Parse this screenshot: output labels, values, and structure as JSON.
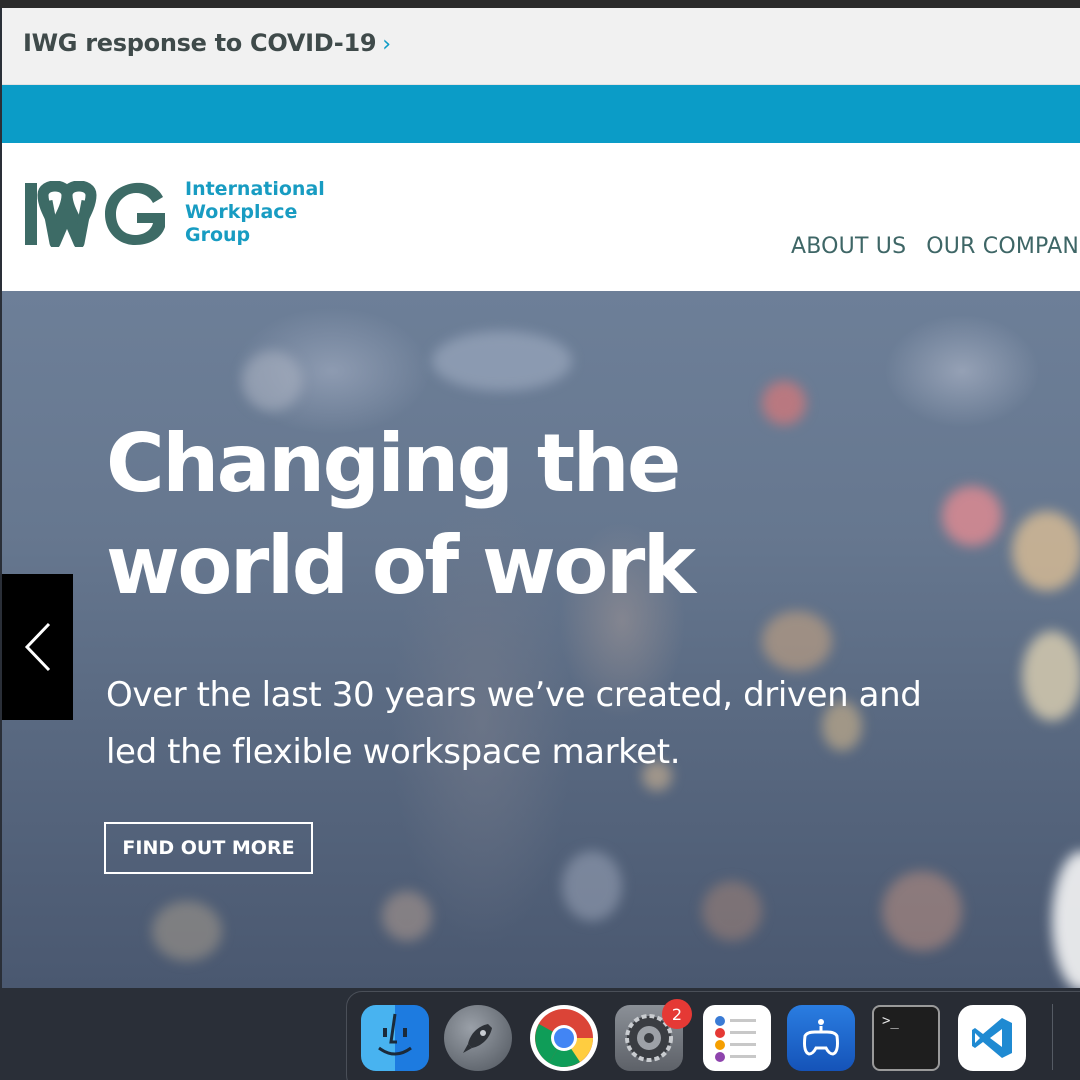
{
  "covid_banner": {
    "link_text": "IWG response to COVID-19",
    "chevron": "›"
  },
  "logo": {
    "mark_text": "IWG",
    "lines": [
      "International",
      "Workplace",
      "Group"
    ]
  },
  "nav": {
    "items": [
      "ABOUT US",
      "OUR COMPANIE"
    ]
  },
  "hero": {
    "title_line1": "Changing the",
    "title_line2": "world of work",
    "subtitle_line1": "Over the last 30 years we’ve created, driven and",
    "subtitle_line2": "led the flexible workspace market.",
    "cta_label": "FIND OUT MORE"
  },
  "dock": {
    "apps": [
      "finder-icon",
      "launchpad-icon",
      "chrome-icon",
      "system-preferences-icon",
      "reminders-icon",
      "controller-app-icon",
      "terminal-icon",
      "vscode-icon"
    ],
    "system_preferences_badge": "2",
    "terminal_prompt": ">_"
  },
  "colors": {
    "brand_teal": "#3d6b66",
    "brand_blue": "#0b9cc7",
    "logo_text_blue": "#189cc2",
    "nav_text": "#3e6666"
  }
}
